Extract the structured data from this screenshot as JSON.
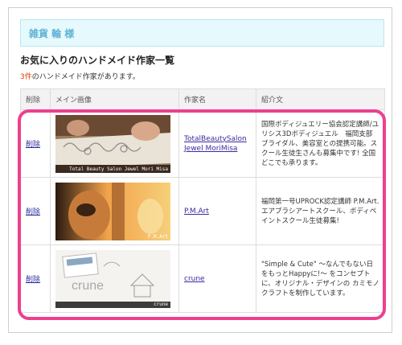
{
  "user_bar": {
    "name": "雑貨 輪",
    "honorific": "様"
  },
  "page_heading": "お気に入りのハンドメイド作家一覧",
  "count_line": {
    "number": "3件",
    "suffix": "のハンドメイド作家があります。"
  },
  "table": {
    "headers": {
      "delete": "削除",
      "image": "メイン画像",
      "creator": "作家名",
      "intro": "紹介文"
    },
    "rows": [
      {
        "delete_label": "削除",
        "image_caption": "Total Beauty Salon Jewel Mori Misa",
        "creator_name": "TotalBeautySalon Jewel MoriMisa",
        "intro": "国際ボディジュエリー協会認定講師/ユリシス3Dボディジュエル　福岡支部　ブライダル、美容室との提携可能。スクール生徒生さんも募集中です! 全国どこでも承ります。"
      },
      {
        "delete_label": "削除",
        "image_caption": "P.M.Art",
        "creator_name": "P.M.Art",
        "intro": "福岡第一号UPROCK認定講師 P.M.Art. エアブラシアートスクール、ボディペイントスクール生徒募集!"
      },
      {
        "delete_label": "削除",
        "image_caption": "crune",
        "image_text": "crune",
        "creator_name": "crune",
        "intro": "\"Simple & Cute\" ～なんでもない日をもっとHappyに!～ をコンセプトに、オリジナル・デザインの カミモノクラフトを制作しています。"
      }
    ]
  },
  "colors": {
    "highlight": "#ee3f8e",
    "user_bar_bg": "#e6f9fd",
    "count_accent": "#e03c00"
  }
}
